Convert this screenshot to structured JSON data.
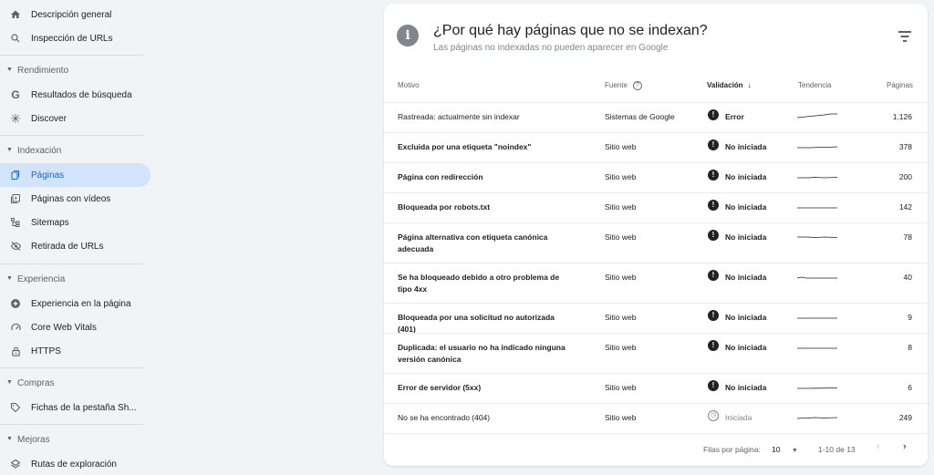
{
  "sidebar": {
    "items": [
      {
        "label": "Descripción general",
        "icon": "home-icon"
      },
      {
        "label": "Inspección de URLs",
        "icon": "search-icon"
      }
    ],
    "sections": [
      {
        "title": "Rendimiento",
        "items": [
          {
            "label": "Resultados de búsqueda",
            "icon": "google-g-icon"
          },
          {
            "label": "Discover",
            "icon": "asterisk-icon"
          }
        ]
      },
      {
        "title": "Indexación",
        "items": [
          {
            "label": "Páginas",
            "icon": "file-copy-icon",
            "active": true
          },
          {
            "label": "Páginas con vídeos",
            "icon": "video-file-icon"
          },
          {
            "label": "Sitemaps",
            "icon": "sitemap-icon"
          },
          {
            "label": "Retirada de URLs",
            "icon": "eye-off-icon"
          }
        ]
      },
      {
        "title": "Experiencia",
        "items": [
          {
            "label": "Experiencia en la página",
            "icon": "add-circle-icon"
          },
          {
            "label": "Core Web Vitals",
            "icon": "speed-icon"
          },
          {
            "label": "HTTPS",
            "icon": "lock-icon"
          }
        ]
      },
      {
        "title": "Compras",
        "items": [
          {
            "label": "Fichas de la pestaña Sh...",
            "icon": "tag-icon"
          }
        ]
      },
      {
        "title": "Mejoras",
        "items": [
          {
            "label": "Rutas de exploración",
            "icon": "layers-icon"
          }
        ]
      }
    ]
  },
  "card": {
    "title": "¿Por qué hay páginas que no se indexan?",
    "subtitle": "Las páginas no indexadas no pueden aparecer en Google",
    "columns": {
      "motivo": "Motivo",
      "fuente": "Fuente",
      "validacion": "Validación",
      "tendencia": "Tendencia",
      "paginas": "Páginas"
    },
    "rows": [
      {
        "motivo": "Rastreada: actualmente sin indexar",
        "fuente": "Sistemas de Google",
        "status": "Error",
        "status_type": "error",
        "pages": "1.126",
        "bold": false
      },
      {
        "motivo": "Excluida por una etiqueta \"noindex\"",
        "fuente": "Sitio web",
        "status": "No iniciada",
        "status_type": "error",
        "pages": "378",
        "bold": true
      },
      {
        "motivo": "Página con redirección",
        "fuente": "Sitio web",
        "status": "No iniciada",
        "status_type": "error",
        "pages": "200",
        "bold": true
      },
      {
        "motivo": "Bloqueada por robots.txt",
        "fuente": "Sitio web",
        "status": "No iniciada",
        "status_type": "error",
        "pages": "142",
        "bold": true
      },
      {
        "motivo": "Página alternativa con etiqueta canónica adecuada",
        "fuente": "Sitio web",
        "status": "No iniciada",
        "status_type": "error",
        "pages": "78",
        "bold": true
      },
      {
        "motivo": "Se ha bloqueado debido a otro problema de tipo 4xx",
        "fuente": "Sitio web",
        "status": "No iniciada",
        "status_type": "error",
        "pages": "40",
        "bold": true
      },
      {
        "motivo": "Bloqueada por una solicitud no autorizada (401)",
        "fuente": "Sitio web",
        "status": "No iniciada",
        "status_type": "error",
        "pages": "9",
        "bold": true
      },
      {
        "motivo": "Duplicada: el usuario no ha indicado ninguna versión canónica",
        "fuente": "Sitio web",
        "status": "No iniciada",
        "status_type": "error",
        "pages": "8",
        "bold": true
      },
      {
        "motivo": "Error de servidor (5xx)",
        "fuente": "Sitio web",
        "status": "No iniciada",
        "status_type": "error",
        "pages": "6",
        "bold": true
      },
      {
        "motivo": "No se ha encontrado (404)",
        "fuente": "Sitio web",
        "status": "Iniciada",
        "status_type": "pending",
        "pages": "249",
        "bold": false
      }
    ],
    "footer": {
      "rows_label": "Filas por página:",
      "rows_value": "10",
      "range": "1-10 de 13"
    }
  },
  "colors": {
    "active_bg": "#d2e3fc",
    "active_text": "#1967d2",
    "background": "#f1f3f4"
  }
}
